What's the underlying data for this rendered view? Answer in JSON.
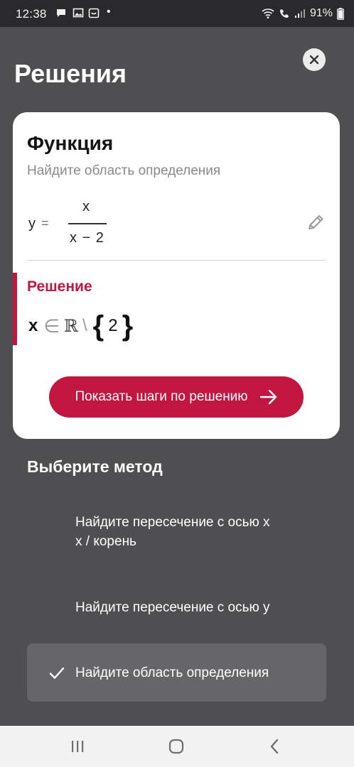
{
  "status_bar": {
    "time": "12:38",
    "battery": "91%",
    "dot": "•"
  },
  "header": {
    "title": "Решения"
  },
  "card": {
    "title": "Функция",
    "subtitle": "Найдите область определения",
    "formula": {
      "lhs": "y",
      "eq": "=",
      "numerator": "x",
      "denominator": "x − 2"
    },
    "solution_label": "Решение",
    "solution": {
      "var": "x",
      "in": "∈",
      "set": "ℝ",
      "setminus": "\\",
      "open_brace": "{",
      "value": "2",
      "close_brace": "}"
    },
    "show_steps_label": "Показать шаги по решению",
    "accent_color": "#c01640"
  },
  "methods": {
    "title": "Выберите метод",
    "items": [
      {
        "line1": "Найдите пересечение с осью x",
        "line2": "x / корень",
        "selected": false
      },
      {
        "line1": "Найдите пересечение с осью y",
        "line2": "",
        "selected": false
      },
      {
        "line1": "Найдите область определения",
        "line2": "",
        "selected": true
      }
    ]
  },
  "icons": {
    "status": [
      "message-icon",
      "image-icon",
      "calendar-icon",
      "wifi-icon",
      "call-icon",
      "signal-icon",
      "battery-icon"
    ],
    "close": "close-icon",
    "edit": "pencil-icon",
    "arrow": "arrow-right-icon",
    "check": "check-icon",
    "nav": [
      "recent-apps-icon",
      "home-icon",
      "back-icon"
    ]
  }
}
